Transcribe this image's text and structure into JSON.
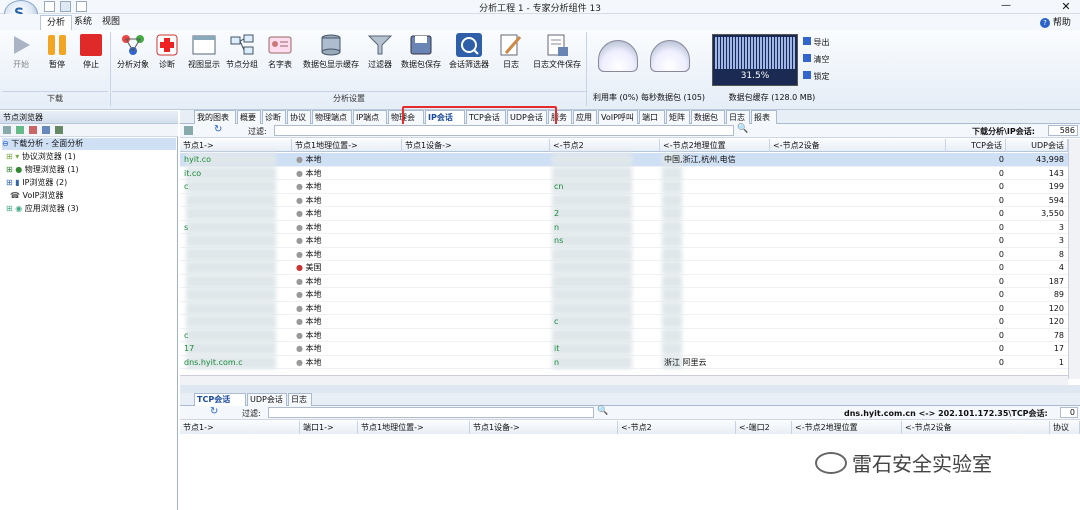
{
  "window": {
    "title": "分析工程 1 - 专家分析组件 13",
    "minimize_icon": "minimize-icon",
    "close_icon": "close-icon",
    "close_label": "✕",
    "min_label": "—"
  },
  "menu": {
    "items": [
      "分析",
      "系统",
      "视图"
    ],
    "help": "帮助"
  },
  "ribbon": {
    "buttons": [
      "开始",
      "暂停",
      "停止",
      "分析对象",
      "诊断",
      "视图显示",
      "节点分组",
      "名字表",
      "数据包显示缓存",
      "过滤器",
      "数据包保存",
      "会话筛选器",
      "日志",
      "日志文件保存"
    ],
    "groups": [
      "下载",
      "分析设置"
    ],
    "gauge_captions": "利用率 (0%) 每秒数据包 (105)",
    "buffer_caption": "数据包缓存 (128.0 MB)",
    "buffer_percent": "31.5%",
    "buffer_fill": 0.315,
    "side_buttons": [
      "导出",
      "清空",
      "锁定"
    ]
  },
  "left_pane": {
    "title": "节点浏览器",
    "tree": [
      {
        "label": "下载分析 - 全面分析",
        "selected": true
      },
      {
        "label": "协议浏览器 (1)"
      },
      {
        "label": "物理浏览器 (1)"
      },
      {
        "label": "IP浏览器 (2)"
      },
      {
        "label": "VoIP浏览器"
      },
      {
        "label": "应用浏览器 (3)"
      }
    ]
  },
  "tabs": [
    "我的图表",
    "概要",
    "诊断",
    "协议",
    "物理端点",
    "IP端点",
    "物理会",
    "IP会话",
    "TCP会话",
    "UDP会话",
    "服务",
    "应用",
    "VoIP呼叫",
    "端口",
    "矩阵",
    "数据包",
    "日志",
    "报表"
  ],
  "active_tab": "IP会话",
  "filter": {
    "label": "过滤:",
    "value": "",
    "right_label": "下载分析\\IP会话:",
    "count": "586"
  },
  "columns": [
    "节点1->",
    "节点1地理位置->",
    "节点1设备->",
    "<-节点2",
    "<-节点2地理位置",
    "<-节点2设备",
    "TCP会话",
    "UDP会话"
  ],
  "rows": [
    {
      "n1": "hyit.co",
      "geo1": "本地",
      "n2": "",
      "geo2": "中国,浙江,杭州,电信",
      "tcp": "0",
      "udp": "43,998",
      "selected": true
    },
    {
      "n1": "it.co",
      "geo1": "本地",
      "n2": "",
      "geo2": "",
      "tcp": "0",
      "udp": "143"
    },
    {
      "n1": "c",
      "geo1": "本地",
      "n2": "cn",
      "geo2": "",
      "tcp": "0",
      "udp": "199"
    },
    {
      "n1": "",
      "geo1": "本地",
      "n2": "",
      "geo2": "",
      "tcp": "0",
      "udp": "594"
    },
    {
      "n1": "",
      "geo1": "本地",
      "n2": "2",
      "geo2": "",
      "tcp": "0",
      "udp": "3,550"
    },
    {
      "n1": "s",
      "geo1": "本地",
      "n2": "n",
      "geo2": "",
      "tcp": "0",
      "udp": "3"
    },
    {
      "n1": "",
      "geo1": "本地",
      "n2": "ns",
      "geo2": "",
      "tcp": "0",
      "udp": "3"
    },
    {
      "n1": "",
      "geo1": "本地",
      "n2": "",
      "geo2": "",
      "tcp": "0",
      "udp": "8"
    },
    {
      "n1": "",
      "geo1": "美国",
      "n2": "",
      "geo2": "",
      "tcp": "0",
      "udp": "4"
    },
    {
      "n1": "",
      "geo1": "本地",
      "n2": "",
      "geo2": "",
      "tcp": "0",
      "udp": "187"
    },
    {
      "n1": "",
      "geo1": "本地",
      "n2": "",
      "geo2": "",
      "tcp": "0",
      "udp": "89"
    },
    {
      "n1": "",
      "geo1": "本地",
      "n2": "",
      "geo2": "",
      "tcp": "0",
      "udp": "120"
    },
    {
      "n1": "",
      "geo1": "本地",
      "n2": "c",
      "geo2": "",
      "tcp": "0",
      "udp": "120"
    },
    {
      "n1": "c",
      "geo1": "本地",
      "n2": "",
      "geo2": "",
      "tcp": "0",
      "udp": "78"
    },
    {
      "n1": "17",
      "geo1": "本地",
      "n2": "it",
      "geo2": "",
      "tcp": "0",
      "udp": "17"
    },
    {
      "n1": "dns.hyit.com.c",
      "geo1": "本地",
      "n2": "n",
      "geo2": "浙江 阿里云",
      "tcp": "0",
      "udp": "1"
    }
  ],
  "bottom": {
    "tabs": [
      "TCP会话",
      "UDP会话",
      "日志"
    ],
    "active_tab": "TCP会话",
    "filter_label": "过滤:",
    "right_label": "dns.hyit.com.cn <-> 202.101.172.35\\TCP会话:",
    "count": "0",
    "columns": [
      "节点1->",
      "端口1->",
      "节点1地理位置->",
      "节点1设备->",
      "<-节点2",
      "<-端口2",
      "<-节点2地理位置",
      "<-节点2设备",
      "协议"
    ]
  },
  "watermark": "雷石安全实验室"
}
